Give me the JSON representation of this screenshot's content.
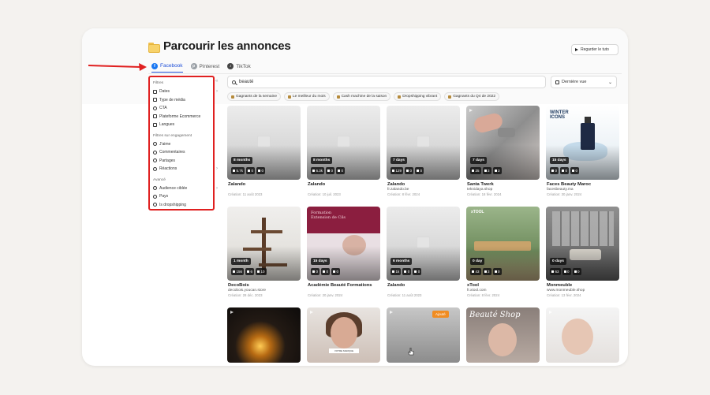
{
  "page": {
    "title": "Parcourir les annonces",
    "tuto_label": "Regarder le tuto"
  },
  "tabs": [
    {
      "label": "Facebook",
      "icon": "facebook-icon",
      "active": true
    },
    {
      "label": "Pinterest",
      "icon": "pinterest-icon",
      "active": false
    },
    {
      "label": "TikTok",
      "icon": "tiktok-icon",
      "active": false
    }
  ],
  "sidebar": {
    "filters_title": "Filtres",
    "filters": [
      "Dates",
      "Type de média",
      "CTA",
      "Plateforme Ecommerce",
      "Langues"
    ],
    "engagement_title": "Filtres sur engagement",
    "engagement": [
      "J'aime",
      "Commentaires",
      "Partages",
      "Réactions"
    ],
    "advanced_title": "Avancé",
    "advanced": [
      "Audience ciblée",
      "Pays",
      "Is dropshipping"
    ]
  },
  "search": {
    "value": "beauté"
  },
  "sort": {
    "label": "Dernière vue"
  },
  "chips": [
    "Gagnants de la semaine",
    "Le meilleur du mois",
    "Cash machine de la saison",
    "Dropshipping vibrant",
    "Gagnants du Q4 de 2022"
  ],
  "cards": [
    {
      "name": "Zalando",
      "domain": "",
      "created": "Création: 11 août 2023",
      "age": "8 months",
      "likes": "5.7k",
      "comments": "0",
      "shares": "0"
    },
    {
      "name": "Zalando",
      "domain": "",
      "created": "Création: 10 juil. 2023",
      "age": "8 months",
      "likes": "6.3k",
      "comments": "0",
      "shares": "0"
    },
    {
      "name": "Zalando",
      "domain": "fr.zalando.be",
      "created": "Création: 8 févr. 2024",
      "age": "7 days",
      "likes": "129",
      "comments": "0",
      "shares": "0"
    },
    {
      "name": "Santa Twerk",
      "domain": "teknidaya.shop",
      "created": "Création: 18 févr. 2024",
      "age": "7 days",
      "likes": "25",
      "comments": "3",
      "shares": "3"
    },
    {
      "name": "Faces Beauty Maroc",
      "domain": "facesbeauty.ma",
      "created": "Création: 30 janv. 2024",
      "age": "15 days",
      "likes": "0",
      "comments": "0",
      "shares": "0",
      "overlay": "WINTER ICONS"
    },
    {
      "name": "DecoBois",
      "domain": "decobois.youcan.store",
      "created": "Création: 28 déc. 2023",
      "age": "1 month",
      "likes": "156",
      "comments": "6",
      "shares": "10"
    },
    {
      "name": "Académie Beauté Formations",
      "domain": "",
      "created": "Création: 20 janv. 2024",
      "age": "15 days",
      "likes": "0",
      "comments": "0",
      "shares": "0",
      "overlay": "Formation Extension de Cils"
    },
    {
      "name": "Zalando",
      "domain": "",
      "created": "Création: 11 août 2023",
      "age": "6 months",
      "likes": "1k",
      "comments": "0",
      "shares": "0"
    },
    {
      "name": "xTool",
      "domain": "fr.xtool.com",
      "created": "Création: 8 févr. 2024",
      "age": "0 day",
      "likes": "43",
      "comments": "3",
      "shares": "0",
      "overlay": "xTOOL"
    },
    {
      "name": "Monmeuble",
      "domain": "www.monmeuble.shop",
      "created": "Création: 13 févr. 2024",
      "age": "0 days",
      "likes": "63",
      "comments": "0",
      "shares": "0"
    },
    {
      "name": "",
      "domain": "",
      "created": "",
      "age": "",
      "likes": "",
      "comments": "",
      "shares": ""
    },
    {
      "name": "",
      "domain": "",
      "created": "",
      "age": "",
      "likes": "",
      "comments": "",
      "shares": "",
      "overlay": "VOTRE MARQUE"
    },
    {
      "name": "",
      "domain": "",
      "created": "",
      "age": "",
      "likes": "",
      "comments": "",
      "shares": "",
      "overlay": "Ajouté"
    },
    {
      "name": "",
      "domain": "",
      "created": "",
      "age": "",
      "likes": "",
      "comments": "",
      "shares": "",
      "overlay": "Beauté Shop"
    },
    {
      "name": "",
      "domain": "",
      "created": "",
      "age": "",
      "likes": "",
      "comments": "",
      "shares": ""
    }
  ],
  "colors": {
    "accent": "#1d4ed8",
    "highlight_border": "#e02020",
    "arrow": "#e02020",
    "background": "#f4f2ef"
  }
}
